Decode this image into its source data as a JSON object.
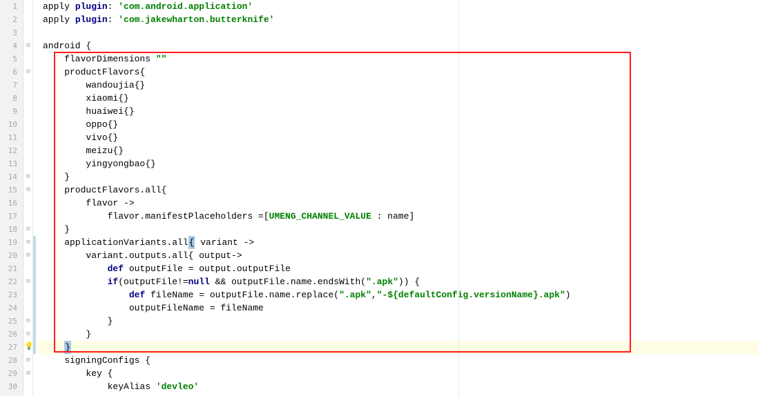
{
  "lines": {
    "1": {
      "num": "1"
    },
    "2": {
      "num": "2"
    },
    "3": {
      "num": "3"
    },
    "4": {
      "num": "4"
    },
    "5": {
      "num": "5"
    },
    "6": {
      "num": "6"
    },
    "7": {
      "num": "7"
    },
    "8": {
      "num": "8"
    },
    "9": {
      "num": "9"
    },
    "10": {
      "num": "10"
    },
    "11": {
      "num": "11"
    },
    "12": {
      "num": "12"
    },
    "13": {
      "num": "13"
    },
    "14": {
      "num": "14"
    },
    "15": {
      "num": "15"
    },
    "16": {
      "num": "16"
    },
    "17": {
      "num": "17"
    },
    "18": {
      "num": "18"
    },
    "19": {
      "num": "19"
    },
    "20": {
      "num": "20"
    },
    "21": {
      "num": "21"
    },
    "22": {
      "num": "22"
    },
    "23": {
      "num": "23"
    },
    "24": {
      "num": "24"
    },
    "25": {
      "num": "25"
    },
    "26": {
      "num": "26"
    },
    "27": {
      "num": "27"
    },
    "28": {
      "num": "28"
    },
    "29": {
      "num": "29"
    },
    "30": {
      "num": "30"
    }
  },
  "t": {
    "apply": "apply ",
    "plugin": "plugin",
    "colon": ": ",
    "s_android_app": "'com.android.application'",
    "s_butterknife": "'com.jakewharton.butterknife'",
    "android_open": "android {",
    "flavorDimensions": "    flavorDimensions ",
    "s_empty": "\"\"",
    "productFlavors_open": "    productFlavors{",
    "wandoujia": "        wandoujia{}",
    "xiaomi": "        xiaomi{}",
    "huaiwei": "        huaiwei{}",
    "oppo": "        oppo{}",
    "vivo": "        vivo{}",
    "meizu": "        meizu{}",
    "yingyongbao": "        yingyongbao{}",
    "close_brace_8": "    }",
    "productFlavors_all_open": "    productFlavors.all{",
    "flavor_arrow": "        flavor ->",
    "flavor_mp_pre": "            flavor.manifestPlaceholders =[",
    "umeng": "UMENG_CHANNEL_VALUE",
    "flavor_mp_post": " : name]",
    "close_brace_4": "    }",
    "appVariants_pre": "    applicationVariants.all",
    "open_brace_sel": "{",
    "appVariants_post": " variant ->",
    "variant_outputs": "        variant.outputs.all{ output->",
    "def1": "            def",
    "outputFile_assign": " outputFile = output.outputFile",
    "if": "            if",
    "if_cond_pre": "(outputFile!=",
    "null": "null",
    "if_cond_mid": " && outputFile.name.endsWith(",
    "s_apk": "\".apk\"",
    "if_cond_post": ")) {",
    "def2": "                def",
    "fileName_pre": " fileName = outputFile.name.replace(",
    "s_apk2": "\".apk\"",
    "comma": ",",
    "s_dash_default": "\"-${defaultConfig.versionName}.apk\"",
    "fileName_post": ")",
    "outputFileName_assign": "                outputFileName = fileName",
    "close_brace_12": "            }",
    "close_brace_8b": "        }",
    "close_brace_cur": "    ",
    "close_brace_cur_sel": "}",
    "signingConfigs_open": "    signingConfigs {",
    "key_open": "        key {",
    "keyAlias": "            keyAlias ",
    "s_devleo": "'devleo'"
  }
}
